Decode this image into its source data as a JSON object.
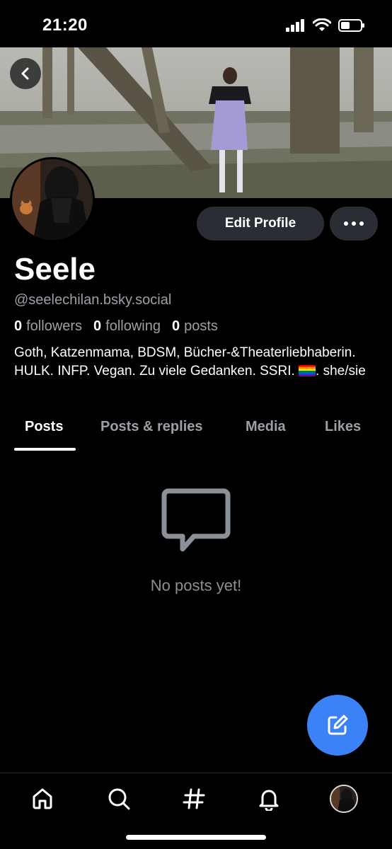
{
  "status_bar": {
    "time": "21:20"
  },
  "profile": {
    "display_name": "Seele",
    "handle": "@seelechilan.bsky.social",
    "stats": {
      "followers_count": "0",
      "followers_label": "followers",
      "following_count": "0",
      "following_label": "following",
      "posts_count": "0",
      "posts_label": "posts"
    },
    "bio_part1": "Goth, Katzenmama, BDSM, Bücher-&Theaterliebhaberin. HULK. INFP. Vegan. Zu viele Gedanken. SSRI. ",
    "bio_part2": ". she/sie",
    "edit_profile_label": "Edit Profile"
  },
  "tabs": [
    {
      "label": "Posts",
      "active": true
    },
    {
      "label": "Posts & replies",
      "active": false
    },
    {
      "label": "Media",
      "active": false
    },
    {
      "label": "Likes",
      "active": false
    }
  ],
  "empty_state": {
    "message": "No posts yet!",
    "icon": "message-square-icon"
  },
  "icons": {
    "back": "chevron-left-icon",
    "more": "more-horizontal-icon",
    "compose": "compose-icon",
    "nav": [
      "home-icon",
      "search-icon",
      "hashtag-icon",
      "bell-icon",
      "profile-avatar"
    ]
  },
  "colors": {
    "accent": "#3b82f6",
    "button_bg": "#2a2d33",
    "muted_text": "#9aa0a6"
  }
}
